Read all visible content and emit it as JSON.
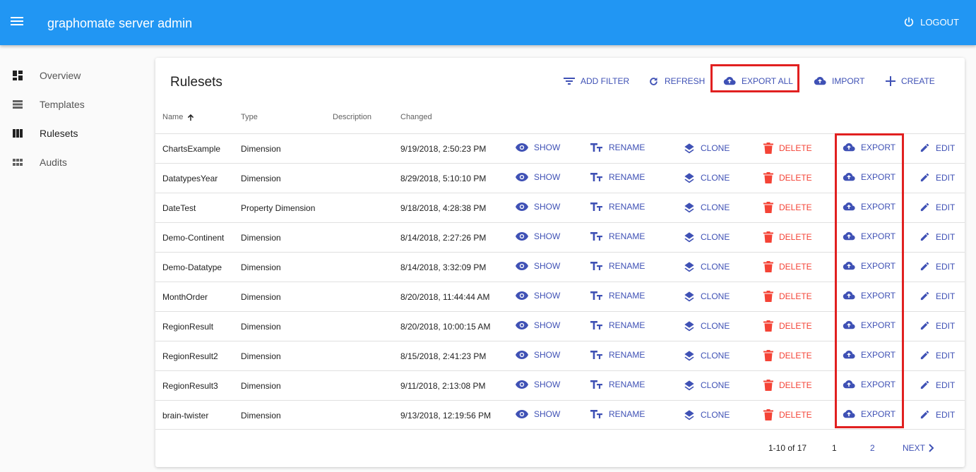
{
  "app": {
    "title": "graphomate server admin",
    "logout_label": "LOGOUT"
  },
  "sidebar": {
    "items": [
      {
        "label": "Overview",
        "icon": "dashboard-icon"
      },
      {
        "label": "Templates",
        "icon": "list-icon"
      },
      {
        "label": "Rulesets",
        "icon": "view-column-icon"
      },
      {
        "label": "Audits",
        "icon": "view-module-icon"
      }
    ]
  },
  "main": {
    "title": "Rulesets",
    "toolbar": {
      "add_filter": "ADD FILTER",
      "refresh": "REFRESH",
      "export_all": "EXPORT ALL",
      "import": "IMPORT",
      "create": "CREATE"
    },
    "columns": {
      "name": "Name",
      "type": "Type",
      "description": "Description",
      "changed": "Changed"
    },
    "actions": {
      "show": "SHOW",
      "rename": "RENAME",
      "clone": "CLONE",
      "delete": "DELETE",
      "export": "EXPORT",
      "edit": "EDIT"
    },
    "rows": [
      {
        "name": "ChartsExample",
        "type": "Dimension",
        "description": "",
        "changed": "9/19/2018, 2:50:23 PM"
      },
      {
        "name": "DatatypesYear",
        "type": "Dimension",
        "description": "",
        "changed": "8/29/2018, 5:10:10 PM"
      },
      {
        "name": "DateTest",
        "type": "Property Dimension",
        "description": "",
        "changed": "9/18/2018, 4:28:38 PM"
      },
      {
        "name": "Demo-Continent",
        "type": "Dimension",
        "description": "",
        "changed": "8/14/2018, 2:27:26 PM"
      },
      {
        "name": "Demo-Datatype",
        "type": "Dimension",
        "description": "",
        "changed": "8/14/2018, 3:32:09 PM"
      },
      {
        "name": "MonthOrder",
        "type": "Dimension",
        "description": "",
        "changed": "8/20/2018, 11:44:44 AM"
      },
      {
        "name": "RegionResult",
        "type": "Dimension",
        "description": "",
        "changed": "8/20/2018, 10:00:15 AM"
      },
      {
        "name": "RegionResult2",
        "type": "Dimension",
        "description": "",
        "changed": "8/15/2018, 2:41:23 PM"
      },
      {
        "name": "RegionResult3",
        "type": "Dimension",
        "description": "",
        "changed": "9/11/2018, 2:13:08 PM"
      },
      {
        "name": "brain-twister",
        "type": "Dimension",
        "description": "",
        "changed": "9/13/2018, 12:19:56 PM"
      }
    ],
    "pagination": {
      "range": "1-10 of 17",
      "pages": [
        "1",
        "2"
      ],
      "next": "NEXT"
    }
  },
  "colors": {
    "appbar": "#2196f3",
    "accent": "#3f51b5",
    "danger": "#f44336",
    "highlight": "#e12020"
  }
}
